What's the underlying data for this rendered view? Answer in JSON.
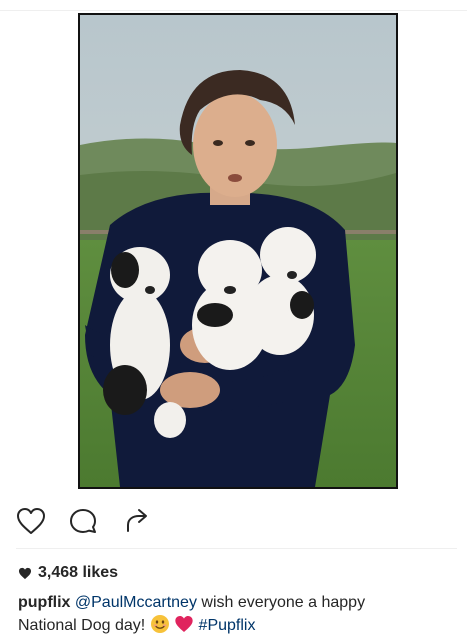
{
  "post": {
    "image_alt_icon": "photo-of-man-holding-puppies",
    "likes_text": "3,468 likes",
    "caption": {
      "username": "pupflix",
      "mention": "@PaulMccartney",
      "text_part1": "wish everyone a happy",
      "text_part2": "National Dog day!",
      "hashtag": "#Pupflix"
    }
  },
  "icons": {
    "like": "heart-outline-icon",
    "comment": "comment-bubble-icon",
    "share": "share-arrow-icon",
    "likes_heart": "heart-filled-icon",
    "emoji_smile": "smiling-face-emoji-icon",
    "emoji_heart": "red-heart-emoji-icon"
  },
  "colors": {
    "text": "#262626",
    "link": "#003569",
    "divider": "#efefef",
    "heart_red": "#e0245e"
  }
}
